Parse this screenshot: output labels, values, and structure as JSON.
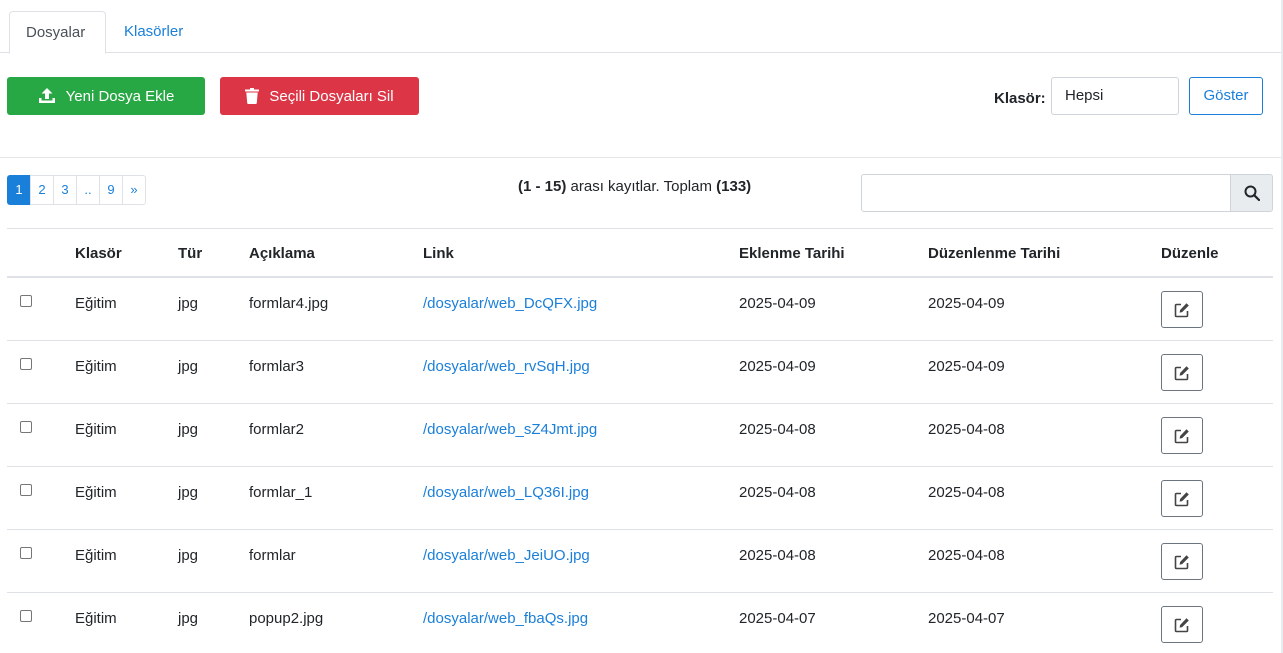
{
  "tabs": [
    {
      "label": "Dosyalar",
      "active": true
    },
    {
      "label": "Klasörler",
      "active": false
    }
  ],
  "toolbar": {
    "add_label": "Yeni Dosya Ekle",
    "delete_label": "Seçili Dosyaları Sil",
    "folder_label": "Klasör:",
    "folder_value": "Hepsi",
    "show_label": "Göster"
  },
  "pagination": {
    "pages": [
      "1",
      "2",
      "3",
      "..",
      "9",
      "»"
    ],
    "active": "1"
  },
  "records": {
    "range": "(1 - 15)",
    "middle": " arası kayıtlar. Toplam ",
    "total": "(133)"
  },
  "search": {
    "placeholder": ""
  },
  "table": {
    "headers": {
      "folder": "Klasör",
      "type": "Tür",
      "desc": "Açıklama",
      "link": "Link",
      "added": "Eklenme Tarihi",
      "edited": "Düzenlenme Tarihi",
      "edit": "Düzenle"
    },
    "rows": [
      {
        "folder": "Eğitim",
        "type": "jpg",
        "desc": "formlar4.jpg",
        "link": "/dosyalar/web_DcQFX.jpg",
        "added": "2025-04-09",
        "edited": "2025-04-09"
      },
      {
        "folder": "Eğitim",
        "type": "jpg",
        "desc": "formlar3",
        "link": "/dosyalar/web_rvSqH.jpg",
        "added": "2025-04-09",
        "edited": "2025-04-09"
      },
      {
        "folder": "Eğitim",
        "type": "jpg",
        "desc": "formlar2",
        "link": "/dosyalar/web_sZ4Jmt.jpg",
        "added": "2025-04-08",
        "edited": "2025-04-08"
      },
      {
        "folder": "Eğitim",
        "type": "jpg",
        "desc": "formlar_1",
        "link": "/dosyalar/web_LQ36I.jpg",
        "added": "2025-04-08",
        "edited": "2025-04-08"
      },
      {
        "folder": "Eğitim",
        "type": "jpg",
        "desc": "formlar",
        "link": "/dosyalar/web_JeiUO.jpg",
        "added": "2025-04-08",
        "edited": "2025-04-08"
      },
      {
        "folder": "Eğitim",
        "type": "jpg",
        "desc": "popup2.jpg",
        "link": "/dosyalar/web_fbaQs.jpg",
        "added": "2025-04-07",
        "edited": "2025-04-07"
      }
    ]
  },
  "icons": {
    "upload": "upload-icon",
    "trash": "trash-icon",
    "search": "search-icon",
    "edit": "edit-icon"
  },
  "colors": {
    "accent": "#1a7fd9",
    "success": "#28a745",
    "danger": "#dc3545"
  }
}
